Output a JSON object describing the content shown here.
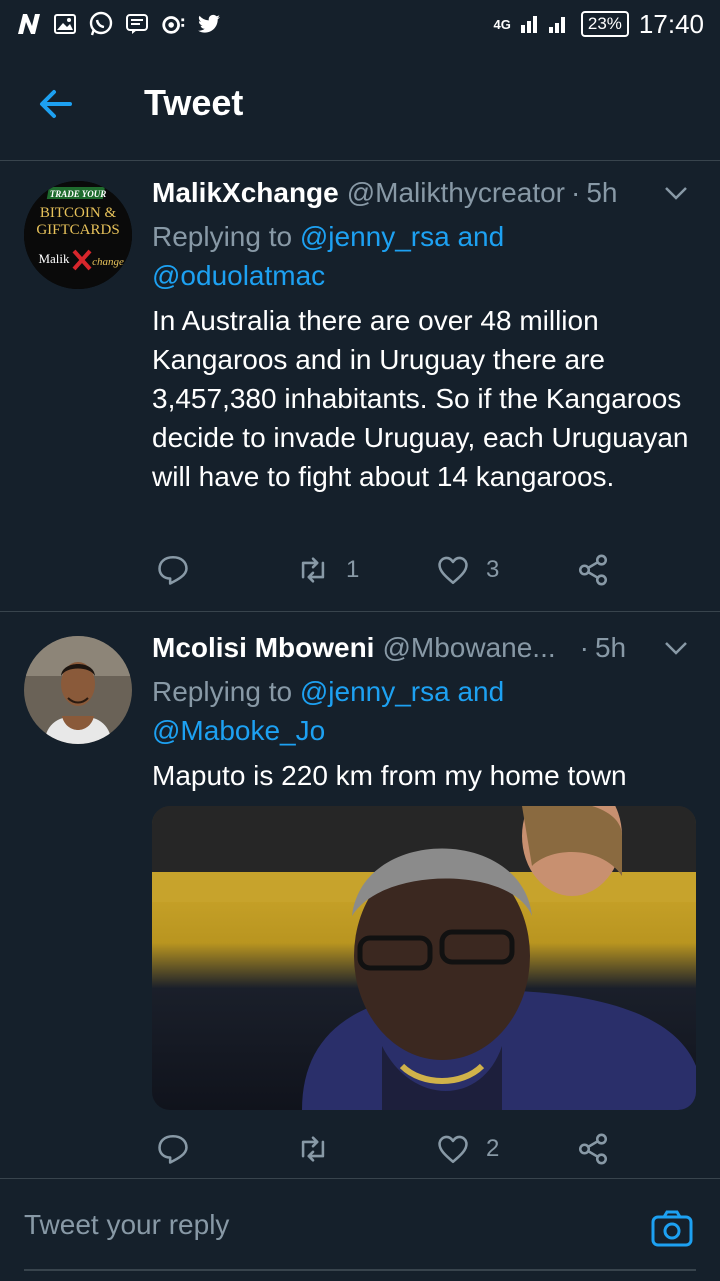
{
  "status_bar": {
    "time": "17:40",
    "battery": "23%",
    "network": "4G",
    "icons": [
      "n-icon",
      "image-icon",
      "whatsapp-icon",
      "message-icon",
      "camera-dot-icon",
      "twitter-icon"
    ]
  },
  "header": {
    "title": "Tweet",
    "back_icon": "arrow-left-icon"
  },
  "tweets": [
    {
      "name": "MalikXchange",
      "handle": "@Malikthycreator",
      "time": "5h",
      "replying_label": "Replying to ",
      "replying_to_1": "@jenny_rsa and",
      "replying_to_2": "@oduolatmac",
      "text": "In Australia there are over 48 million Kangaroos and in Uruguay there are 3,457,380 inhabitants. So if the Kangaroos decide to invade Uruguay, each Uruguayan will have to fight about 14 kangaroos.",
      "retweets": "1",
      "likes": "3",
      "avatar_text": {
        "line1": "TRADE YOUR",
        "line2": "BITCOIN &",
        "line3": "GIFTCARDS",
        "line4": "Malik",
        "line5": "change"
      }
    },
    {
      "name": "Mcolisi Mboweni",
      "handle": "@Mbowane...",
      "time": "5h",
      "replying_label": "Replying to ",
      "replying_to_1": "@jenny_rsa and",
      "replying_to_2": "@Maboke_Jo",
      "text": "Maputo is 220 km from my home town",
      "retweets": "",
      "likes": "2"
    }
  ],
  "compose": {
    "placeholder": "Tweet your reply"
  },
  "colors": {
    "background": "#15202b",
    "accent": "#1da1f2",
    "muted": "#8899a6",
    "divider": "#38444d"
  }
}
